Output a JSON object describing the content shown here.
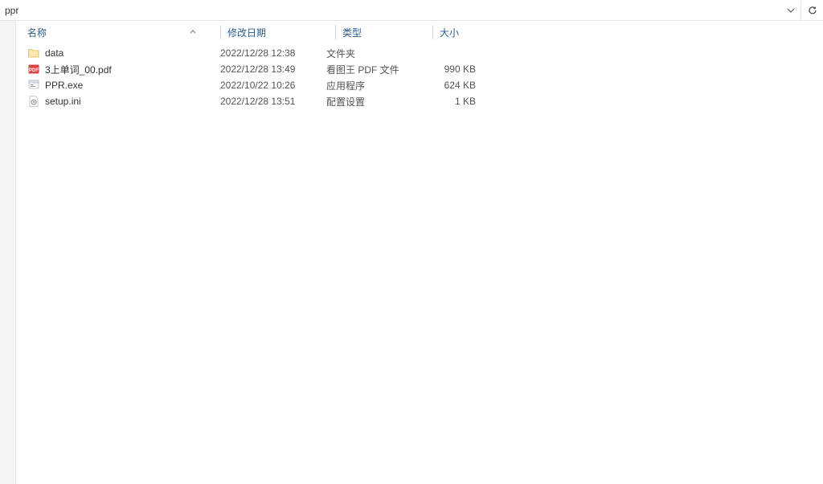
{
  "addressBar": {
    "path": "ppr"
  },
  "columns": {
    "name": "名称",
    "date": "修改日期",
    "type": "类型",
    "size": "大小"
  },
  "items": [
    {
      "icon": "folder",
      "name": "data",
      "date": "2022/12/28 12:38",
      "type": "文件夹",
      "size": ""
    },
    {
      "icon": "pdf",
      "name": "3上单词_00.pdf",
      "date": "2022/12/28 13:49",
      "type": "看图王 PDF 文件",
      "size": "990 KB"
    },
    {
      "icon": "exe",
      "name": "PPR.exe",
      "date": "2022/10/22 10:26",
      "type": "应用程序",
      "size": "624 KB"
    },
    {
      "icon": "ini",
      "name": "setup.ini",
      "date": "2022/12/28 13:51",
      "type": "配置设置",
      "size": "1 KB"
    }
  ]
}
